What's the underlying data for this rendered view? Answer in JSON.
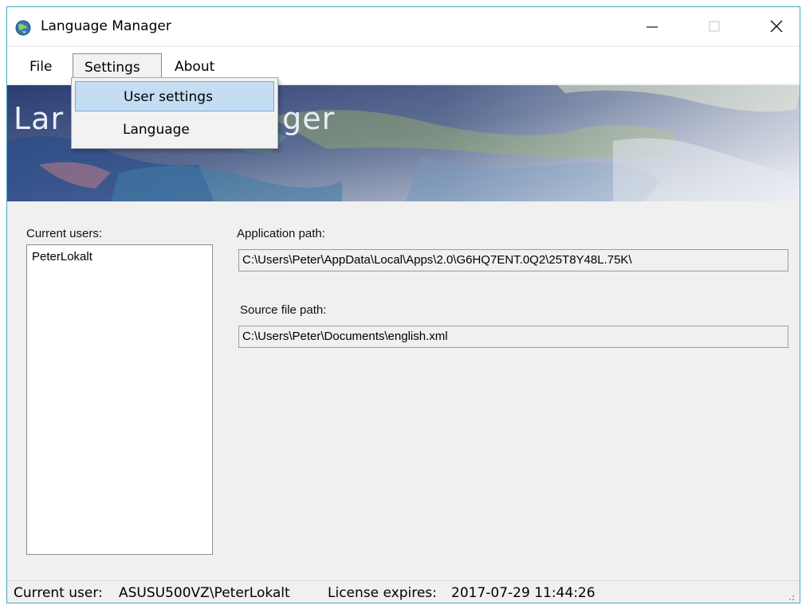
{
  "window": {
    "title": "Language Manager",
    "accent_border": "#45a7c8"
  },
  "menu": {
    "items": [
      {
        "label": "File"
      },
      {
        "label": "Settings"
      },
      {
        "label": "About"
      }
    ],
    "settings_dropdown": [
      {
        "label": "User settings",
        "highlighted": true
      },
      {
        "label": "Language"
      }
    ]
  },
  "banner": {
    "title_visible_left": "Lar",
    "title_visible_right": "ger"
  },
  "users": {
    "label": "Current users:",
    "items": [
      "PeterLokalt"
    ]
  },
  "paths": {
    "app_label": "Application path:",
    "app_value": "C:\\Users\\Peter\\AppData\\Local\\Apps\\2.0\\G6HQ7ENT.0Q2\\25T8Y48L.75K\\",
    "source_label": "Source file path:",
    "source_value": "C:\\Users\\Peter\\Documents\\english.xml"
  },
  "status": {
    "user_label": "Current user:",
    "user_value": "ASUSU500VZ\\PeterLokalt",
    "license_label": "License expires:",
    "license_value": "2017-07-29 11:44:26"
  }
}
